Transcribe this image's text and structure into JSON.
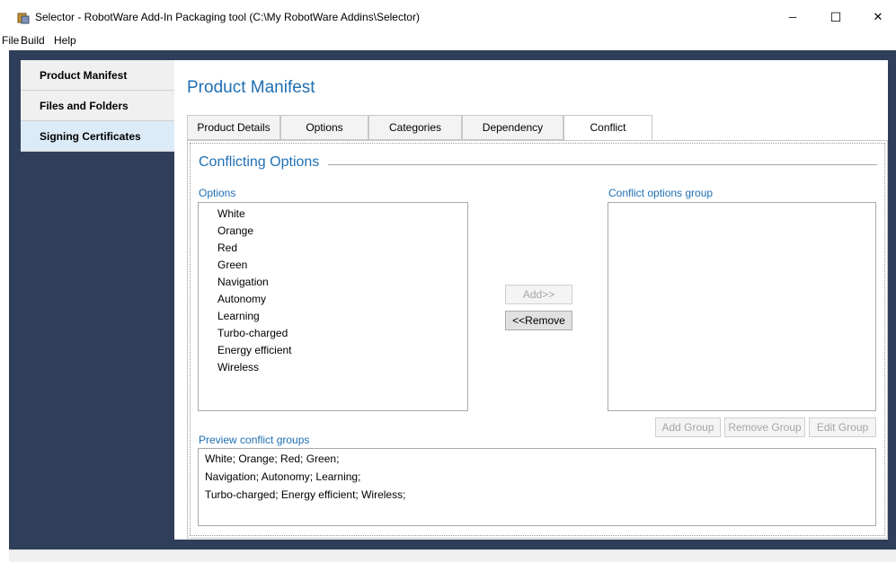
{
  "window": {
    "title": "Selector - RobotWare Add-In Packaging tool (C:\\My RobotWare Addins\\Selector)",
    "minimize_glyph": "─",
    "maximize_glyph": "☐",
    "close_glyph": "✕"
  },
  "menu": [
    "File",
    "Build",
    "Help"
  ],
  "sidebar": {
    "items": [
      {
        "label": "Product Manifest",
        "active": false
      },
      {
        "label": "Files and Folders",
        "active": false
      },
      {
        "label": "Signing Certificates",
        "active": true
      }
    ]
  },
  "main": {
    "title": "Product Manifest",
    "tabs": [
      {
        "label": "Product Details"
      },
      {
        "label": "Options"
      },
      {
        "label": "Categories"
      },
      {
        "label": "Dependency"
      },
      {
        "label": "Conflict",
        "active": true
      }
    ]
  },
  "conflict": {
    "section_title": "Conflicting Options",
    "options_label": "Options",
    "options": [
      "White",
      "Orange",
      "Red",
      "Green",
      "Navigation",
      "Autonomy",
      "Learning",
      "Turbo-charged",
      "Energy efficient",
      "Wireless"
    ],
    "group_label": "Conflict options group",
    "add_button": "Add>>",
    "remove_button": "<<Remove",
    "add_group_button": "Add Group",
    "remove_group_button": "Remove Group",
    "edit_group_button": "Edit Group",
    "preview_label": "Preview conflict groups",
    "preview_lines": [
      "White; Orange; Red; Green;",
      "Navigation; Autonomy; Learning;",
      "Turbo-charged; Energy efficient; Wireless;"
    ]
  },
  "colors": {
    "accent": "#1f6fb2",
    "frame": "#2f3e5a",
    "nav_active": "#dcebf8"
  }
}
